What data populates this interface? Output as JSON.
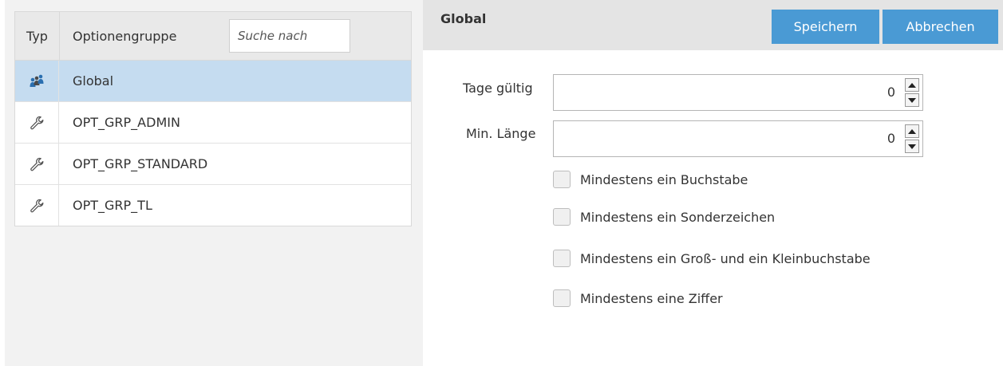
{
  "list": {
    "header": {
      "typ_label": "Typ",
      "group_label": "Optionengruppe",
      "search_placeholder": "Suche nach"
    },
    "rows": [
      {
        "icon": "users-icon",
        "name": "Global",
        "selected": true
      },
      {
        "icon": "wrench-icon",
        "name": "OPT_GRP_ADMIN"
      },
      {
        "icon": "wrench-icon",
        "name": "OPT_GRP_STANDARD"
      },
      {
        "icon": "wrench-icon",
        "name": "OPT_GRP_TL"
      }
    ]
  },
  "detail": {
    "title": "Global",
    "save_label": "Speichern",
    "cancel_label": "Abbrechen",
    "fields": [
      {
        "label": "Tage gültig",
        "value": "0"
      },
      {
        "label": "Min. Länge",
        "value": "0"
      }
    ],
    "checkboxes": [
      {
        "label": "Mindestens ein Buchstabe",
        "checked": false
      },
      {
        "label": "Mindestens ein Sonderzeichen",
        "checked": false
      },
      {
        "label": "Mindestens ein Groß- und ein Kleinbuchstabe",
        "checked": false
      },
      {
        "label": "Mindestens eine Ziffer",
        "checked": false
      }
    ]
  },
  "colors": {
    "accent": "#4a9ad4",
    "selected_row": "#c5dcf0",
    "header_bg": "#e4e4e4"
  }
}
